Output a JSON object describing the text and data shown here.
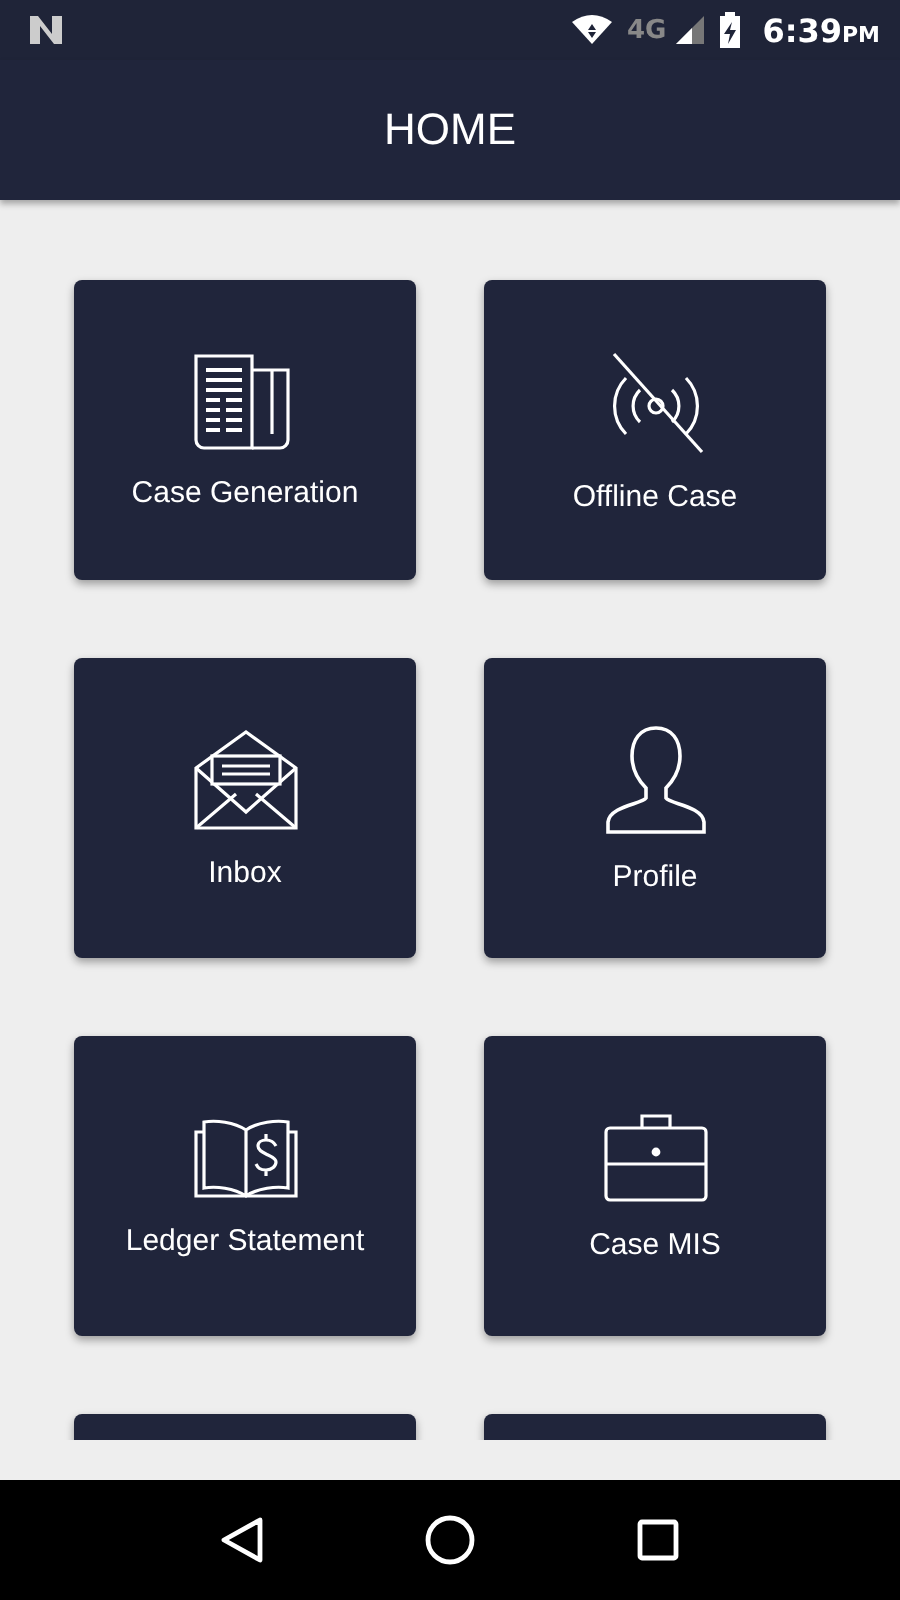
{
  "status_bar": {
    "network": "4G",
    "time": "6:39",
    "ampm": "PM"
  },
  "app_bar": {
    "title": "HOME"
  },
  "tiles": [
    {
      "kind": "newspaper",
      "label": "Case Generation"
    },
    {
      "kind": "offline",
      "label": "Offline Case"
    },
    {
      "kind": "envelope",
      "label": "Inbox"
    },
    {
      "kind": "person",
      "label": "Profile"
    },
    {
      "kind": "book",
      "label": "Ledger Statement"
    },
    {
      "kind": "briefcase",
      "label": "Case MIS"
    },
    {
      "kind": "cut"
    },
    {
      "kind": "cut"
    }
  ]
}
